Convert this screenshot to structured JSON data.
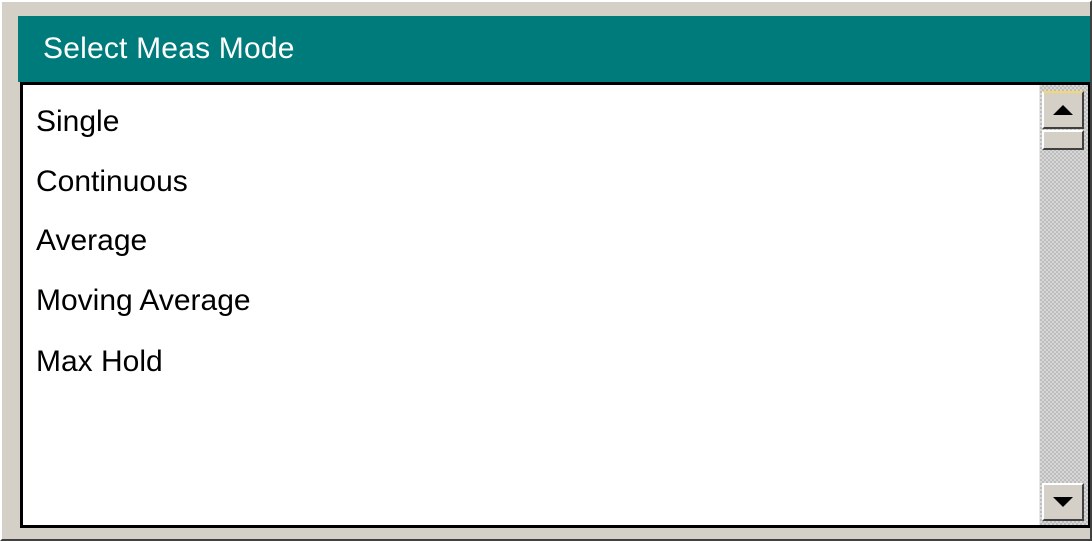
{
  "dialog": {
    "title": "Select Meas Mode"
  },
  "list": {
    "items": [
      {
        "label": "Single"
      },
      {
        "label": "Continuous"
      },
      {
        "label": "Average"
      },
      {
        "label": "Moving Average"
      },
      {
        "label": "Max Hold"
      }
    ]
  },
  "scrollbar": {
    "up_icon": "scroll-up-arrow-icon",
    "down_icon": "scroll-down-arrow-icon"
  },
  "colors": {
    "title_bar": "#007b7b",
    "title_text": "#ffffff",
    "list_background": "#ffffff",
    "chrome": "#d4d0c8"
  }
}
